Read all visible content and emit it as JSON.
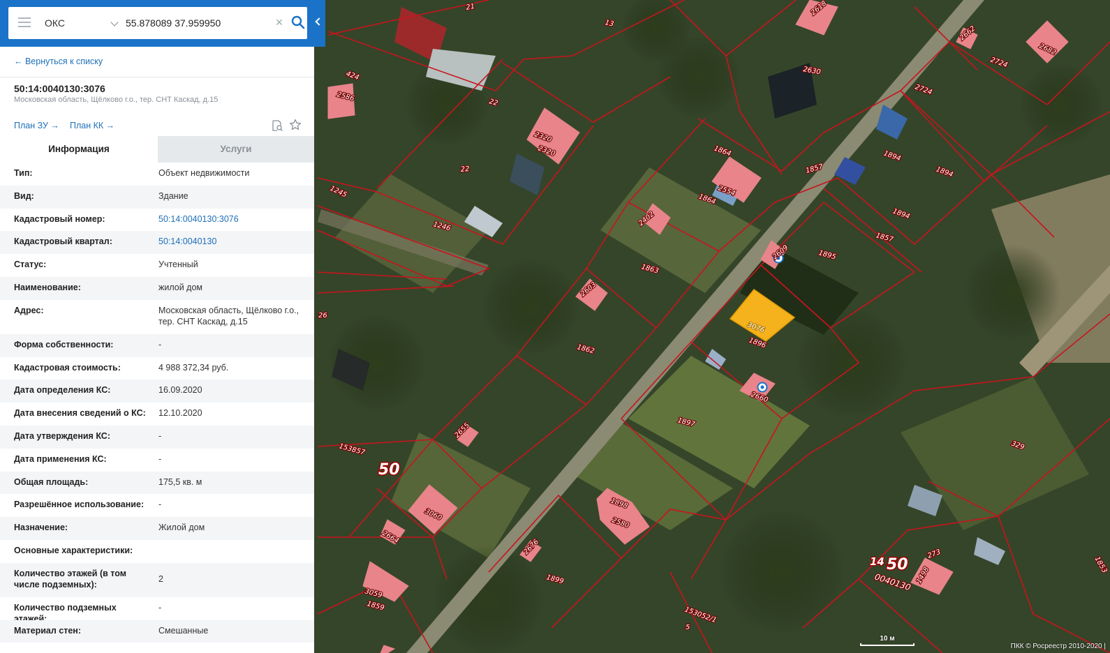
{
  "search": {
    "type_value": "ОКС",
    "coordinates_value": "55.878089 37.959950"
  },
  "panel": {
    "back_label": "← Вернуться к списку",
    "object_number": "50:14:0040130:3076",
    "object_address": "Московская область, Щёлково г.о., тер. СНТ Каскад, д.15",
    "plan_zu_label": "План ЗУ →",
    "plan_kk_label": "План КК →",
    "tabs": [
      {
        "label": "Информация",
        "active": true
      },
      {
        "label": "Услуги",
        "active": false
      }
    ],
    "rows": [
      {
        "label": "Тип:",
        "value": "Объект недвижимости"
      },
      {
        "label": "Вид:",
        "value": "Здание"
      },
      {
        "label": "Кадастровый номер:",
        "value": "50:14:0040130:3076"
      },
      {
        "label": "Кадастровый квартал:",
        "value": "50:14:0040130"
      },
      {
        "label": "Статус:",
        "value": "Учтенный"
      },
      {
        "label": "Наименование:",
        "value": "жилой дом"
      },
      {
        "label": "Адрес:",
        "value": "Московская область, Щёлково г.о., тер. СНТ Каскад, д.15"
      },
      {
        "label": "Форма собственности:",
        "value": "-"
      },
      {
        "label": "Кадастровая стоимость:",
        "value": "4 988 372,34 руб."
      },
      {
        "label": "Дата определения КС:",
        "value": "16.09.2020"
      },
      {
        "label": "Дата внесения сведений о КС:",
        "value": "12.10.2020"
      },
      {
        "label": "Дата утверждения КС:",
        "value": "-"
      },
      {
        "label": "Дата применения КС:",
        "value": "-"
      },
      {
        "label": "Общая площадь:",
        "value": "175,5 кв. м"
      },
      {
        "label": "Разрешённое использование:",
        "value": "-"
      },
      {
        "label": "Назначение:",
        "value": "Жилой дом"
      },
      {
        "label": "Основные характеристики:",
        "value": ""
      },
      {
        "label": "Количество этажей (в том числе подземных):",
        "value": "2"
      },
      {
        "label": "Количество подземных этажей:",
        "value": "-"
      },
      {
        "label": "Материал стен:",
        "value": "Смешанные"
      }
    ]
  },
  "map": {
    "colors": {
      "boundary": "#c8141e",
      "building": "#e8848a",
      "selected": "#f5b21c"
    },
    "plot_labels": [
      "21",
      "13",
      "2618",
      "2662",
      "2682",
      "424",
      "2586",
      "22",
      "2630",
      "2724",
      "2724",
      "2320",
      "2320",
      "22",
      "1864",
      "1894",
      "1894",
      "1857",
      "1245",
      "2554",
      "1864",
      "1246",
      "2402",
      "1894",
      "1857",
      "1895",
      "2609",
      "1863",
      "2603",
      "3076",
      "1896",
      "1862",
      "2660",
      "1897",
      "2655",
      "153857",
      "329",
      "1898",
      "2580",
      "3060",
      "2664",
      "2676",
      "1899",
      "273",
      "1498",
      "3059",
      "1859",
      "153052/1",
      "5",
      "1853",
      "26"
    ],
    "quarter_labels": [
      "50",
      "14",
      "50",
      "0040130"
    ],
    "scale_label": "10 м",
    "copyright": "ПКК © Росреестр 2010-2020 |"
  }
}
